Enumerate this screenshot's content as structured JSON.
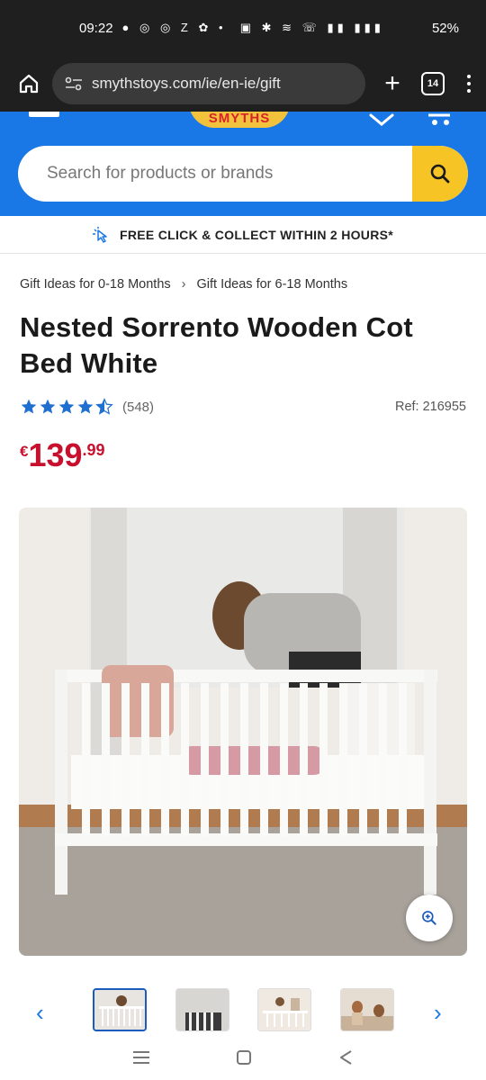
{
  "status_bar": {
    "time": "09:22",
    "battery": "52%"
  },
  "browser": {
    "url": "smythstoys.com/ie/en-ie/gift",
    "tab_count": "14"
  },
  "site": {
    "logo_text": "SMYTHS",
    "search_placeholder": "Search for products or brands",
    "brand_blue": "#1a78e6",
    "brand_yellow": "#f6c525"
  },
  "promo": {
    "text": "FREE CLICK & COLLECT WITHIN 2 HOURS*"
  },
  "breadcrumbs": [
    "Gift Ideas for 0-18 Months",
    "Gift Ideas for 6-18 Months"
  ],
  "product": {
    "title": "Nested Sorrento Wooden Cot Bed White",
    "rating": 4.5,
    "review_count": "(548)",
    "ref": "Ref: 216955",
    "price_currency": "€",
    "price_main": "139",
    "price_cents": ".99",
    "price_color": "#c8102e"
  },
  "gallery": {
    "thumbnail_count": 4,
    "selected_index": 0
  }
}
